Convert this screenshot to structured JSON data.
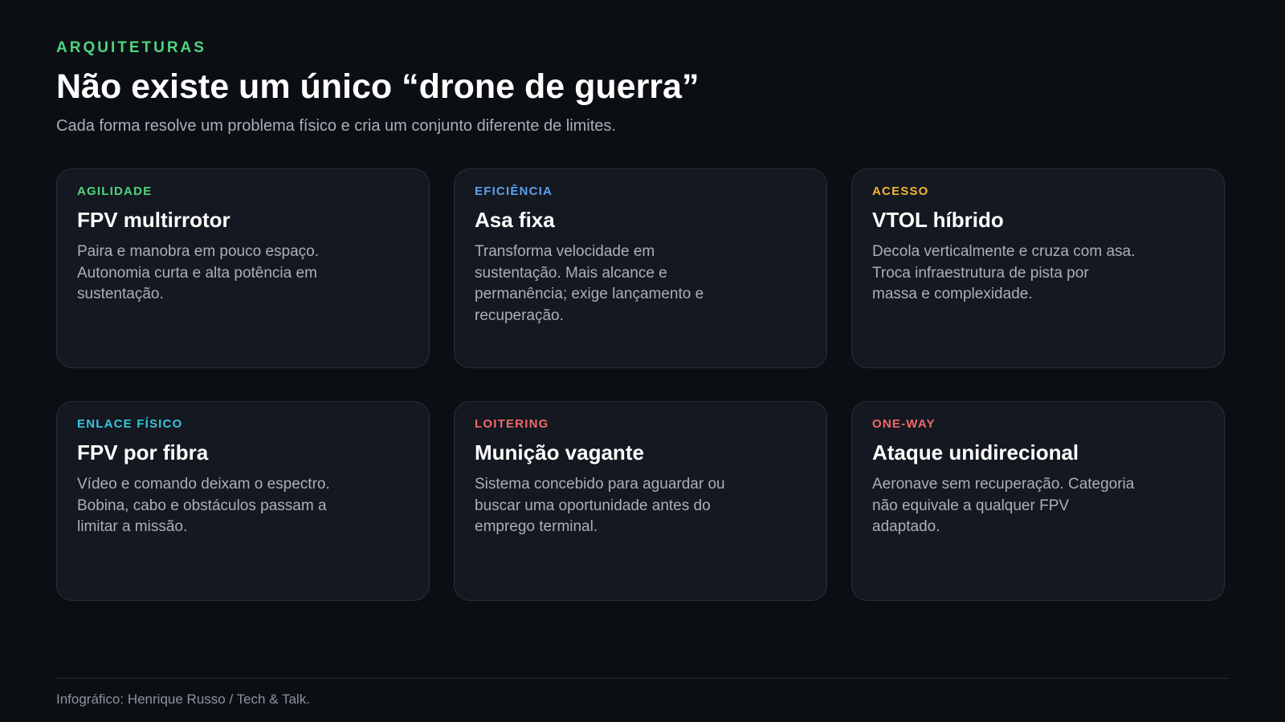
{
  "header": {
    "eyebrow": "ARQUITETURAS",
    "title": "Não existe um único “drone de guerra”",
    "subtitle": "Cada forma resolve um problema físico e cria um conjunto diferente de limites."
  },
  "colors": {
    "eyebrow": "#4fd57e",
    "background": "#0b0e13",
    "card_background": "#141820"
  },
  "cards": [
    {
      "tag": "AGILIDADE",
      "tag_color": "#4fd57e",
      "title": "FPV multirrotor",
      "text": "Paira e manobra em pouco espaço. Autonomia curta e alta potência em sustentação."
    },
    {
      "tag": "EFICIÊNCIA",
      "tag_color": "#5aa2ee",
      "title": "Asa fixa",
      "text": "Transforma velocidade em sustentação. Mais alcance e permanência; exige lançamento e recuperação."
    },
    {
      "tag": "ACESSO",
      "tag_color": "#f2b630",
      "title": "VTOL híbrido",
      "text": "Decola verticalmente e cruza com asa. Troca infraestrutura de pista por massa e complexidade."
    },
    {
      "tag": "ENLACE FÍSICO",
      "tag_color": "#38c6dc",
      "title": "FPV por fibra",
      "text": "Vídeo e comando deixam o espectro. Bobina, cabo e obstáculos passam a limitar a missão."
    },
    {
      "tag": "LOITERING",
      "tag_color": "#f06a6a",
      "title": "Munição vagante",
      "text": "Sistema concebido para aguardar ou buscar uma oportunidade antes do emprego terminal."
    },
    {
      "tag": "ONE-WAY",
      "tag_color": "#f06a6a",
      "title": "Ataque unidirecional",
      "text": "Aeronave sem recuperação. Categoria não equivale a qualquer FPV adaptado."
    }
  ],
  "footer": {
    "credit": "Infográfico: Henrique Russo / Tech & Talk."
  }
}
